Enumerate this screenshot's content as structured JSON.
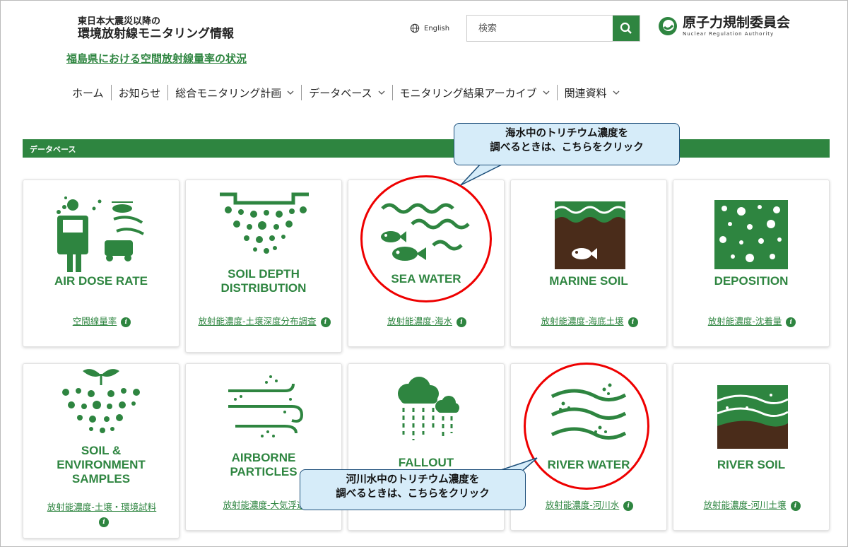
{
  "header": {
    "title_line1": "東日本大震災以降の",
    "title_line2": "環境放射線モニタリング情報",
    "subtitle": "福島県における空間放射線量率の状況",
    "language": "English",
    "search_placeholder": "検索",
    "logo_name": "原子力規制委員会",
    "logo_en": "Nuclear Regulation Authority"
  },
  "nav": {
    "items": [
      {
        "label": "ホーム"
      },
      {
        "label": "お知らせ"
      },
      {
        "label": "総合モニタリング計画"
      },
      {
        "label": "データベース"
      },
      {
        "label": "モニタリング結果アーカイブ"
      },
      {
        "label": "関連資料"
      }
    ]
  },
  "section": {
    "title": "データベース"
  },
  "cards": [
    {
      "label": "AIR DOSE RATE",
      "link": "空間線量率"
    },
    {
      "label": "SOIL DEPTH DISTRIBUTION",
      "link": "放射能濃度-土壌深度分布調査"
    },
    {
      "label": "SEA WATER",
      "link": "放射能濃度-海水"
    },
    {
      "label": "MARINE SOIL",
      "link": "放射能濃度-海底土壌"
    },
    {
      "label": "DEPOSITION",
      "link": "放射能濃度-沈着量"
    },
    {
      "label": "SOIL & ENVIRONMENT SAMPLES",
      "link": "放射能濃度-土壌・環境試料"
    },
    {
      "label": "AIRBORNE PARTICLES",
      "link": "放射能濃度-大気浮遊"
    },
    {
      "label": "FALLOUT",
      "link": ""
    },
    {
      "label": "RIVER WATER",
      "link": "放射能濃度-河川水"
    },
    {
      "label": "RIVER SOIL",
      "link": "放射能濃度-河川土壌"
    }
  ],
  "callouts": {
    "sea_line1": "海水中のトリチウム濃度を",
    "sea_line2": "調べるときは、こちらをクリック",
    "river_line1": "河川水中のトリチウム濃度を",
    "river_line2": "調べるときは、こちらをクリック"
  },
  "colors": {
    "brand_green": "#2e8540",
    "highlight_red": "#e00000",
    "callout_bg": "#d6ecf9"
  }
}
